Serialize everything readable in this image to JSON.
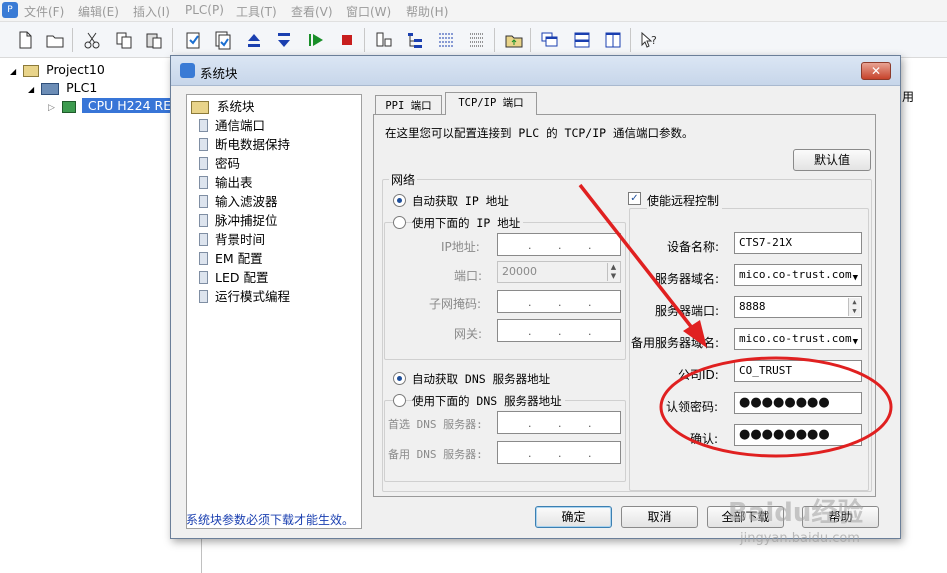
{
  "menubar": {
    "items": [
      "文件(F)",
      "编辑(E)",
      "插入(I)",
      "PLC(P)",
      "工具(T)",
      "查看(V)",
      "窗口(W)",
      "帮助(H)"
    ]
  },
  "tree": {
    "project": "Project10",
    "plc": "PLC1",
    "cpu": "CPU H224 RE"
  },
  "dialog": {
    "title": "系统块",
    "close": "✕",
    "config_tree": {
      "root": "系统块",
      "items": [
        "通信端口",
        "断电数据保持",
        "密码",
        "输出表",
        "输入滤波器",
        "脉冲捕捉位",
        "背景时间",
        "EM 配置",
        "LED 配置",
        "运行模式编程"
      ]
    },
    "tabs": [
      "PPI 端口",
      "TCP/IP 端口"
    ],
    "description": "在这里您可以配置连接到 PLC 的 TCP/IP 通信端口参数。",
    "default_button": "默认值",
    "network": {
      "group_label": "网络",
      "auto_ip": "自动获取 IP 地址",
      "manual_ip": "使用下面的 IP 地址",
      "ip_label": "IP地址:",
      "port_label": "端口:",
      "port_value": "20000",
      "subnet_label": "子网掩码:",
      "gateway_label": "网关:",
      "auto_dns": "自动获取 DNS 服务器地址",
      "manual_dns": "使用下面的 DNS 服务器地址",
      "primary_dns_label": "首选 DNS 服务器:",
      "backup_dns_label": "备用 DNS 服务器:"
    },
    "remote": {
      "enable_label": "使能远程控制",
      "device_name_label": "设备名称:",
      "device_name_value": "CTS7-21X",
      "server_domain_label": "服务器域名:",
      "server_domain_value": "mico.co-trust.com",
      "server_port_label": "服务器端口:",
      "server_port_value": "8888",
      "backup_domain_label": "备用服务器域名:",
      "backup_domain_value": "mico.co-trust.com",
      "company_id_label": "公司ID:",
      "company_id_value": "CO_TRUST",
      "auth_password_label": "认领密码:",
      "auth_password_value": "●●●●●●●●",
      "confirm_label": "确认:",
      "confirm_value": "●●●●●●●●"
    },
    "footer_note": "系统块参数必须下载才能生效。",
    "ok_button": "确定",
    "cancel_button": "取消",
    "apply_all_button": "全部下载",
    "help_button": "帮助"
  },
  "watermark": {
    "line1": "Baidu经验",
    "line2": "jingyan.baidu.com"
  },
  "colors": {
    "annotation_red": "#e02020",
    "link_blue": "#1a3fb0",
    "selection": "#3875d7"
  }
}
